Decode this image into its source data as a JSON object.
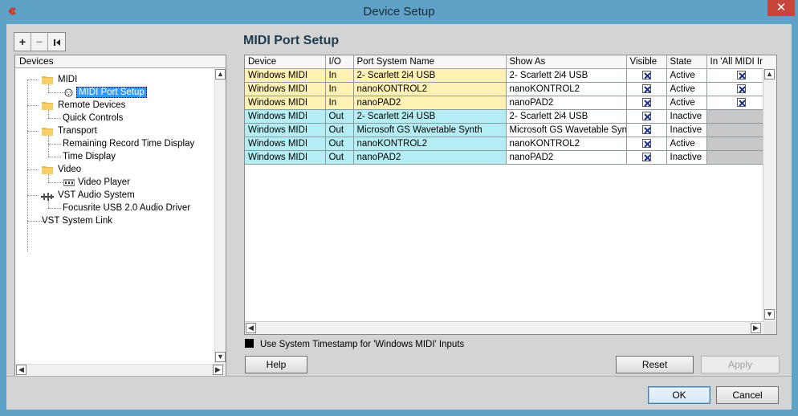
{
  "window": {
    "title": "Device Setup",
    "close_glyph": "✕",
    "accent": "#5fa2c8",
    "close_color": "#c7463b"
  },
  "toolbar": {
    "add_glyph": "+",
    "remove_glyph": "−",
    "reset_glyph": "⏮"
  },
  "devices": {
    "header": "Devices",
    "items": [
      {
        "label": "MIDI",
        "icon": "folder-icon"
      },
      {
        "label": "MIDI Port Setup",
        "icon": "port-icon",
        "selected": true
      },
      {
        "label": "Remote Devices",
        "icon": "folder-icon"
      },
      {
        "label": "Quick Controls"
      },
      {
        "label": "Transport",
        "icon": "folder-icon"
      },
      {
        "label": "Remaining Record Time Display"
      },
      {
        "label": "Time Display"
      },
      {
        "label": "Video",
        "icon": "folder-icon"
      },
      {
        "label": "Video Player",
        "icon": "video-icon"
      },
      {
        "label": "VST Audio System",
        "icon": "audio-system-icon"
      },
      {
        "label": "Focusrite USB 2.0 Audio Driver"
      },
      {
        "label": "VST System Link"
      }
    ]
  },
  "main": {
    "title": "MIDI Port Setup",
    "columns": [
      "Device",
      "I/O",
      "Port System Name",
      "Show As",
      "Visible",
      "State",
      "In 'All MIDI Ir"
    ],
    "rows": [
      {
        "device": "Windows MIDI",
        "io": "In",
        "port": "2- Scarlett 2i4 USB",
        "show_as": "2- Scarlett 2i4 USB",
        "visible": true,
        "state": "Active",
        "all_midi": true
      },
      {
        "device": "Windows MIDI",
        "io": "In",
        "port": "nanoKONTROL2",
        "show_as": "nanoKONTROL2",
        "visible": true,
        "state": "Active",
        "all_midi": true
      },
      {
        "device": "Windows MIDI",
        "io": "In",
        "port": "nanoPAD2",
        "show_as": "nanoPAD2",
        "visible": true,
        "state": "Active",
        "all_midi": true
      },
      {
        "device": "Windows MIDI",
        "io": "Out",
        "port": "2- Scarlett 2i4 USB",
        "show_as": "2- Scarlett 2i4 USB",
        "visible": true,
        "state": "Inactive",
        "all_midi": null
      },
      {
        "device": "Windows MIDI",
        "io": "Out",
        "port": "Microsoft GS Wavetable Synth",
        "show_as": "Microsoft GS Wavetable Synth",
        "visible": true,
        "state": "Inactive",
        "all_midi": null
      },
      {
        "device": "Windows MIDI",
        "io": "Out",
        "port": "nanoKONTROL2",
        "show_as": "nanoKONTROL2",
        "visible": true,
        "state": "Active",
        "all_midi": null
      },
      {
        "device": "Windows MIDI",
        "io": "Out",
        "port": "nanoPAD2",
        "show_as": "nanoPAD2",
        "visible": true,
        "state": "Inactive",
        "all_midi": null
      }
    ],
    "row_colors": {
      "in": "#fff0b4",
      "out": "#b4eef4",
      "disabled": "#c8c8c8"
    },
    "timestamp_label": "Use System Timestamp for 'Windows MIDI' Inputs",
    "help_label": "Help",
    "reset_label": "Reset",
    "apply_label": "Apply"
  },
  "footer": {
    "ok_label": "OK",
    "cancel_label": "Cancel"
  }
}
